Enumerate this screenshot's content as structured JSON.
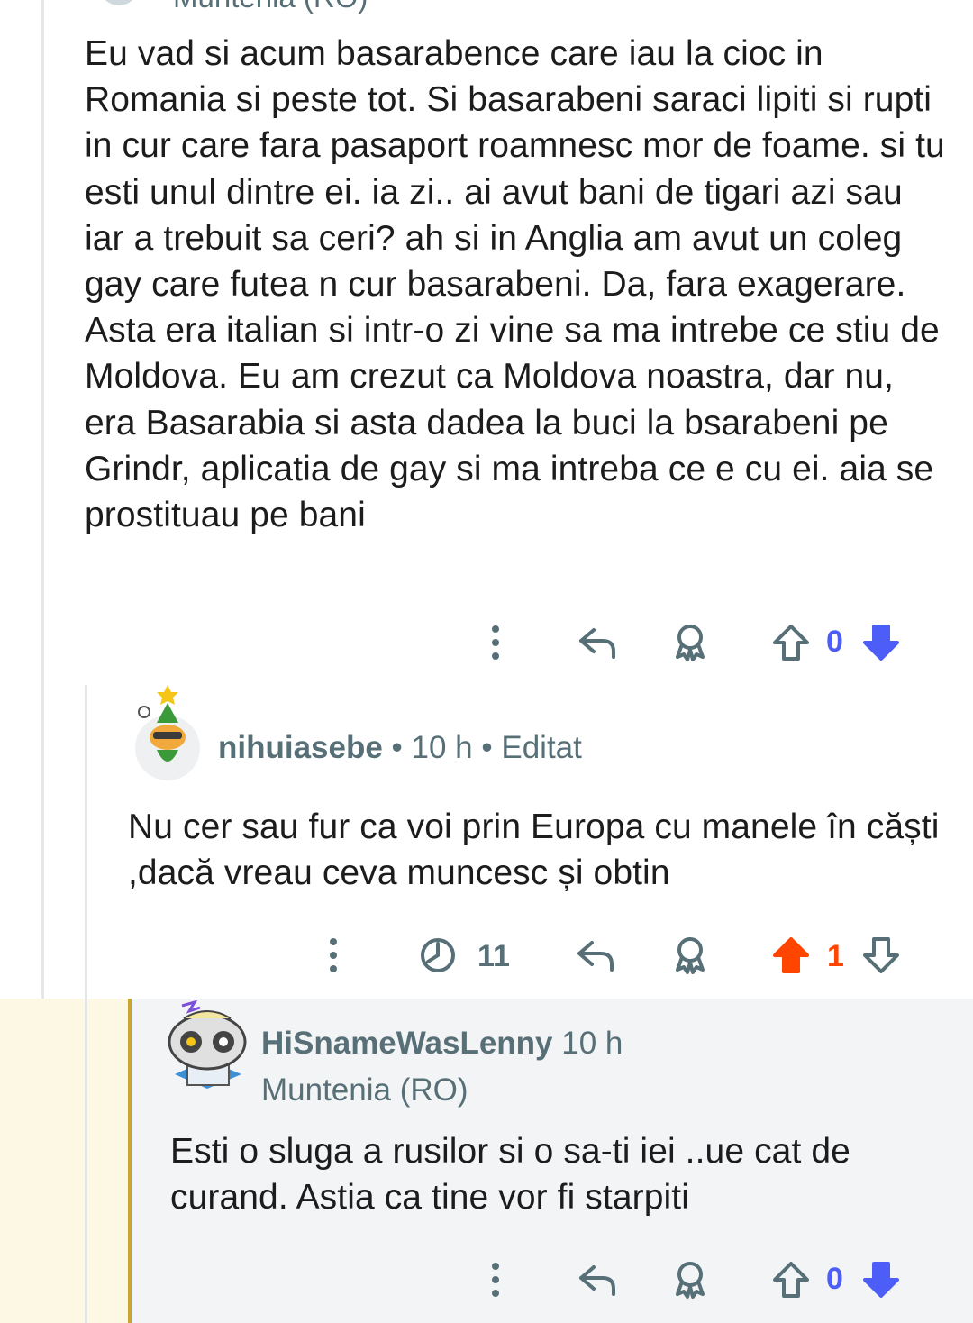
{
  "comment1": {
    "author_partial": "Muntenia (RO)",
    "body": "Eu vad si acum basarabence care iau la cioc in Romania si peste tot. Si basarabeni saraci lipiti si rupti in cur care fara pasaport roamnesc mor de foame. si tu esti unul dintre ei. ia zi.. ai avut bani de tigari azi sau iar a trebuit sa ceri? ah si in Anglia am avut un coleg gay care futea n cur basarabeni. Da, fara exagerare. Asta era italian si intr-o zi vine sa ma intrebe ce stiu de Moldova. Eu am crezut ca Moldova noastra, dar nu, era Basarabia si asta dadea la buci la bsarabeni pe Grindr, aplicatia de gay si ma intreba ce e cu ei. aia se prostituau pe bani",
    "vote_count": "0"
  },
  "comment2": {
    "author": "nihuiasebe",
    "meta": " • 10 h • Editat",
    "body": "Nu cer sau fur ca voi prin Europa cu manele în căști ,dacă vreau ceva muncesc și obtin",
    "time_count": "11",
    "vote_count": "1"
  },
  "comment3": {
    "author": "HiSnameWasLenny",
    "time": " 10 h",
    "flair": "Muntenia (RO)",
    "body": "Esti o sluga a rusilor si o sa-ti iei ..ue cat de curand. Astia ca tine vor fi starpiti",
    "vote_count": "0"
  },
  "colors": {
    "upvote_active": "#ff4500",
    "downvote_active": "#4c5ef7",
    "icon_gray": "#576f76",
    "highlight_bg": "#fdf8e3",
    "highlight_border": "#c9a531"
  },
  "icons": [
    "more-options-icon",
    "reply-icon",
    "award-icon",
    "upvote-icon",
    "downvote-icon",
    "clock-icon"
  ]
}
